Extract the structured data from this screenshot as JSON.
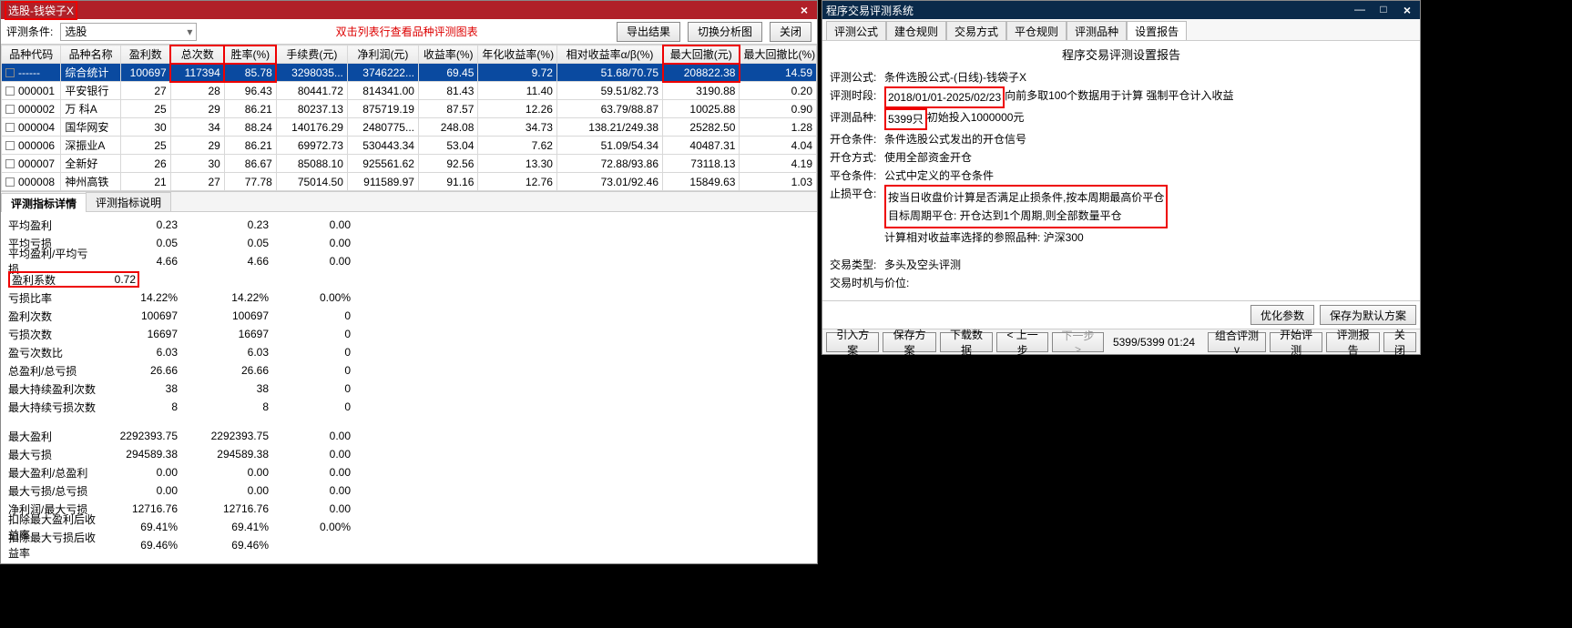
{
  "left": {
    "title": "选股-钱袋子X",
    "toolbar": {
      "cond_label": "评测条件:",
      "cond_value": "选股",
      "hint": "双击列表行查看品种评测图表",
      "btn_export": "导出结果",
      "btn_switch": "切换分析图",
      "btn_close": "关闭"
    },
    "columns": [
      "品种代码",
      "品种名称",
      "盈利数",
      "总次数",
      "胜率(%)",
      "手续费(元)",
      "净利润(元)",
      "收益率(%)",
      "年化收益率(%)",
      "相对收益率α/β(%)",
      "最大回撤(元)",
      "最大回撤比(%)"
    ],
    "hl_cols": [
      3,
      4,
      10
    ],
    "rows": [
      {
        "sel": true,
        "code": "------",
        "name": "综合统计",
        "c": [
          "100697",
          "117394",
          "85.78",
          "3298035...",
          "3746222...",
          "69.45",
          "9.72",
          "51.68/70.75",
          "208822.38",
          "14.59"
        ]
      },
      {
        "code": "000001",
        "name": "平安银行",
        "c": [
          "27",
          "28",
          "96.43",
          "80441.72",
          "814341.00",
          "81.43",
          "11.40",
          "59.51/82.73",
          "3190.88",
          "0.20"
        ]
      },
      {
        "code": "000002",
        "name": "万 科A",
        "c": [
          "25",
          "29",
          "86.21",
          "80237.13",
          "875719.19",
          "87.57",
          "12.26",
          "63.79/88.87",
          "10025.88",
          "0.90"
        ]
      },
      {
        "code": "000004",
        "name": "国华网安",
        "c": [
          "30",
          "34",
          "88.24",
          "140176.29",
          "2480775...",
          "248.08",
          "34.73",
          "138.21/249.38",
          "25282.50",
          "1.28"
        ]
      },
      {
        "code": "000006",
        "name": "深振业A",
        "c": [
          "25",
          "29",
          "86.21",
          "69972.73",
          "530443.34",
          "53.04",
          "7.62",
          "51.09/54.34",
          "40487.31",
          "4.04"
        ]
      },
      {
        "code": "000007",
        "name": "全新好",
        "c": [
          "26",
          "30",
          "86.67",
          "85088.10",
          "925561.62",
          "92.56",
          "13.30",
          "72.88/93.86",
          "73118.13",
          "4.19"
        ]
      },
      {
        "code": "000008",
        "name": "神州高铁",
        "c": [
          "21",
          "27",
          "77.78",
          "75014.50",
          "911589.97",
          "91.16",
          "12.76",
          "73.01/92.46",
          "15849.63",
          "1.03"
        ]
      }
    ],
    "tabs": {
      "t1": "评测指标详情",
      "t2": "评测指标说明"
    },
    "metrics": [
      {
        "k": "平均盈利",
        "v1": "0.23",
        "v2": "0.23",
        "v3": "0.00"
      },
      {
        "k": "平均亏损",
        "v1": "0.05",
        "v2": "0.05",
        "v3": "0.00"
      },
      {
        "k": "平均盈利/平均亏损",
        "v1": "4.66",
        "v2": "4.66",
        "v3": "0.00"
      },
      {
        "k": "盈利系数",
        "v1": "0.72",
        "hl": true
      },
      {
        "k": "亏损比率",
        "v1": "14.22%",
        "v2": "14.22%",
        "v3": "0.00%"
      },
      {
        "k": "盈利次数",
        "v1": "100697",
        "v2": "100697",
        "v3": "0"
      },
      {
        "k": "亏损次数",
        "v1": "16697",
        "v2": "16697",
        "v3": "0"
      },
      {
        "k": "盈亏次数比",
        "v1": "6.03",
        "v2": "6.03",
        "v3": "0"
      },
      {
        "k": "总盈利/总亏损",
        "v1": "26.66",
        "v2": "26.66",
        "v3": "0"
      },
      {
        "k": "最大持续盈利次数",
        "v1": "38",
        "v2": "38",
        "v3": "0"
      },
      {
        "k": "最大持续亏损次数",
        "v1": "8",
        "v2": "8",
        "v3": "0"
      },
      {
        "gap": true
      },
      {
        "k": "最大盈利",
        "v1": "2292393.75",
        "v2": "2292393.75",
        "v3": "0.00"
      },
      {
        "k": "最大亏损",
        "v1": "294589.38",
        "v2": "294589.38",
        "v3": "0.00"
      },
      {
        "k": "最大盈利/总盈利",
        "v1": "0.00",
        "v2": "0.00",
        "v3": "0.00"
      },
      {
        "k": "最大亏损/总亏损",
        "v1": "0.00",
        "v2": "0.00",
        "v3": "0.00"
      },
      {
        "k": "净利润/最大亏损",
        "v1": "12716.76",
        "v2": "12716.76",
        "v3": "0.00"
      },
      {
        "k": "扣除最大盈利后收益率",
        "v1": "69.41%",
        "v2": "69.41%",
        "v3": "0.00%"
      },
      {
        "k": "扣除最大亏损后收益率",
        "v1": "69.46%",
        "v2": "69.46%",
        "v3": ""
      }
    ]
  },
  "right": {
    "title": "程序交易评测系统",
    "tabs": [
      "评测公式",
      "建仓规则",
      "交易方式",
      "平仓规则",
      "评测品种",
      "设置报告"
    ],
    "active_tab": 5,
    "report": {
      "title": "程序交易评测设置报告",
      "formula_k": "评测公式:",
      "formula_v": "条件选股公式-(日线)-钱袋子X",
      "period_k": "评测时段:",
      "period_v": "2018/01/01-2025/02/23",
      "period_after": "向前多取100个数据用于计算 强制平仓计入收益",
      "variety_k": "评测品种:",
      "variety_v": "5399只",
      "variety_after": "初始投入1000000元",
      "open_cond_k": "开仓条件:",
      "open_cond_v": "条件选股公式发出的开仓信号",
      "open_mode_k": "开仓方式:",
      "open_mode_v": "使用全部资金开仓",
      "close_cond_k": "平仓条件:",
      "close_cond_v": "公式中定义的平仓条件",
      "stop_k": "止损平仓:",
      "stop_line1": "按当日收盘价计算是否满足止损条件,按本周期最高价平仓",
      "stop_line2": "目标周期平仓: 开仓达到1个周期,则全部数量平仓",
      "rel_line": "计算相对收益率选择的参照品种: 沪深300",
      "trade_type_k": "交易类型:",
      "trade_type_v": "多头及空头评测",
      "trade_time_k": "交易时机与价位:",
      "trade_time_v": "",
      "btn_opt": "优化参数",
      "btn_savedef": "保存为默认方案"
    },
    "bottombar": {
      "btn_import": "引入方案",
      "btn_save": "保存方案",
      "btn_dl": "下载数据",
      "btn_prev": "< 上一步",
      "btn_next": "下一步 >",
      "status": "5399/5399  01:24",
      "btn_combo": "组合评测v",
      "btn_start": "开始评测",
      "btn_report": "评测报告",
      "btn_close": "关闭"
    }
  }
}
